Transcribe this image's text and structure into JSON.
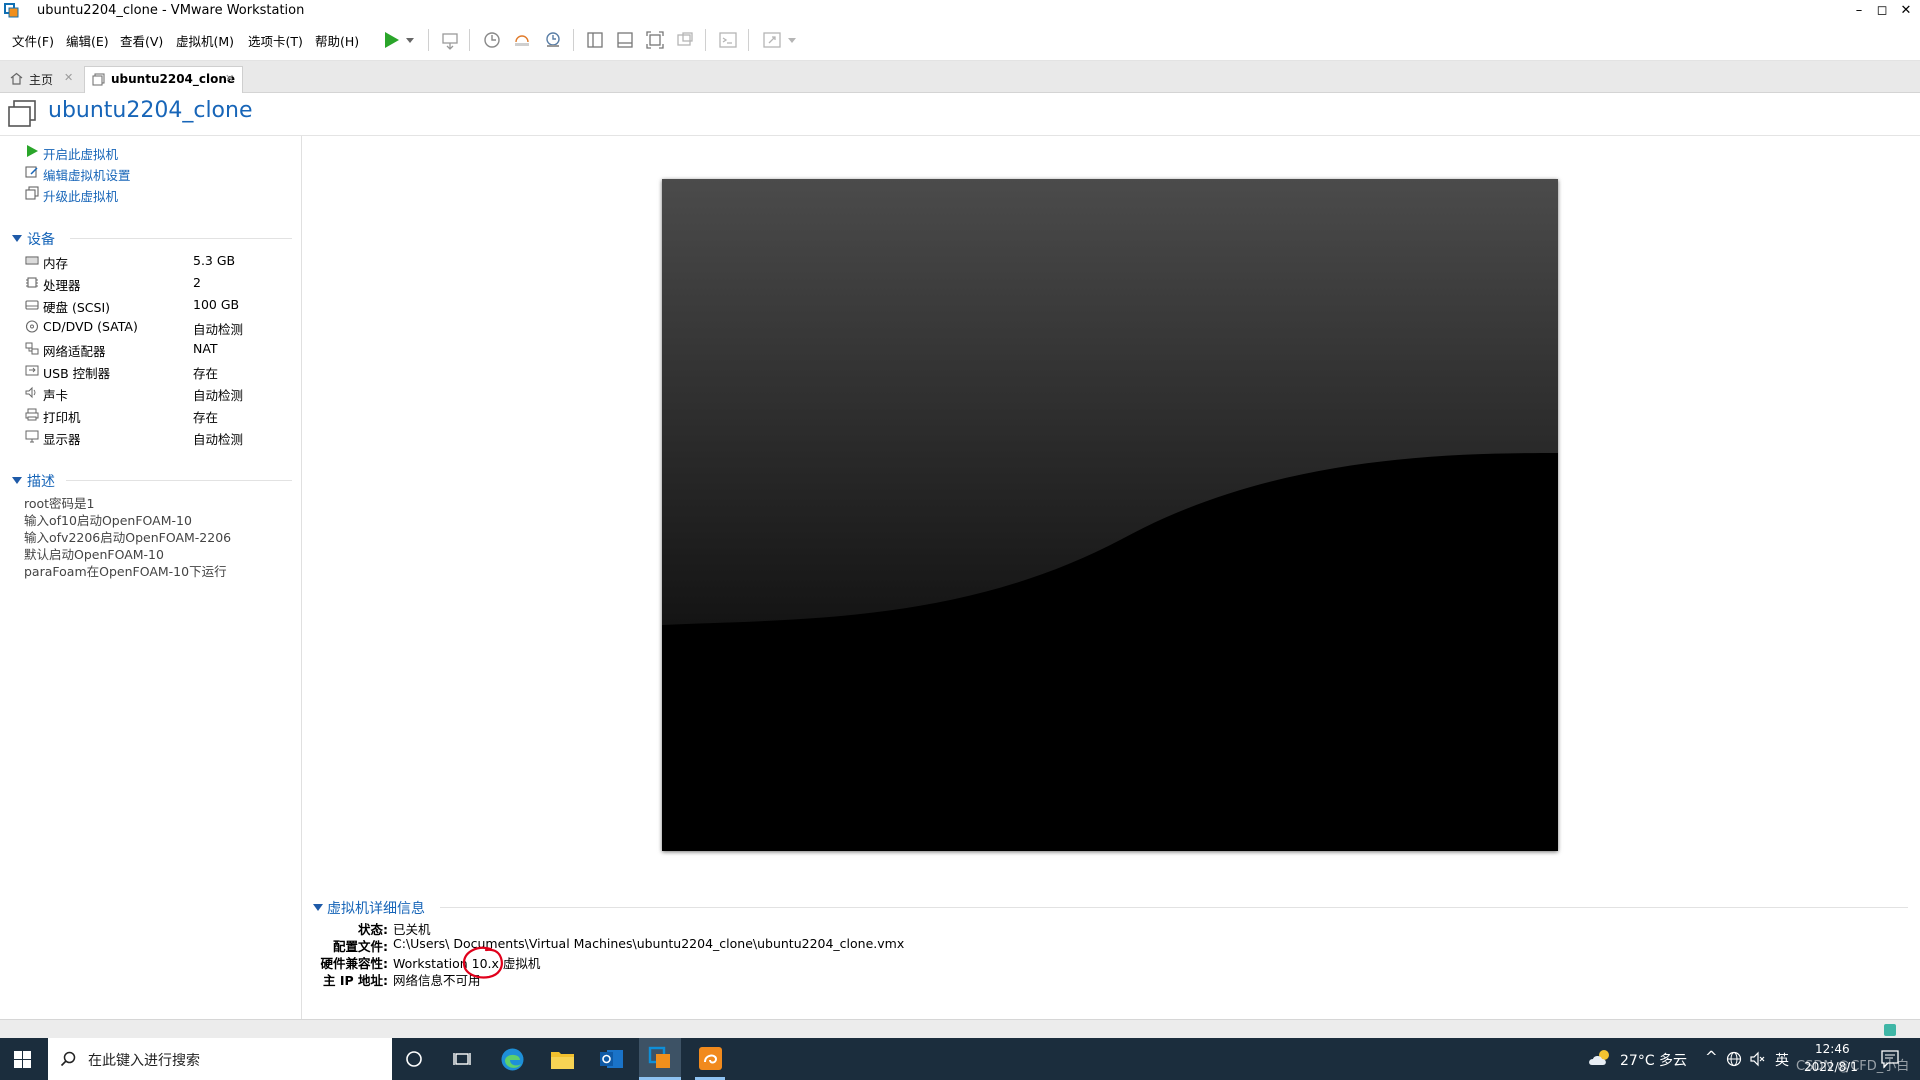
{
  "window": {
    "title": "ubuntu2204_clone - VMware Workstation",
    "minimize": "–",
    "maximize": "◻",
    "close": "✕"
  },
  "menu": {
    "items": [
      "文件(F)",
      "编辑(E)",
      "查看(V)",
      "虚拟机(M)",
      "选项卡(T)",
      "帮助(H)"
    ]
  },
  "tabs": {
    "home": "主页",
    "vm": "ubuntu2204_clone",
    "close_glyph": "✕"
  },
  "vm": {
    "name": "ubuntu2204_clone"
  },
  "actions": {
    "power_on": "开启此虚拟机",
    "edit_settings": "编辑虚拟机设置",
    "upgrade": "升级此虚拟机"
  },
  "devices": {
    "title": "设备",
    "items": [
      {
        "name": "内存",
        "value": "5.3 GB",
        "icon": "memory-icon"
      },
      {
        "name": "处理器",
        "value": "2",
        "icon": "cpu-icon"
      },
      {
        "name": "硬盘 (SCSI)",
        "value": "100 GB",
        "icon": "harddisk-icon"
      },
      {
        "name": "CD/DVD (SATA)",
        "value": "自动检测",
        "icon": "cdrom-icon"
      },
      {
        "name": "网络适配器",
        "value": "NAT",
        "icon": "network-icon"
      },
      {
        "name": "USB 控制器",
        "value": "存在",
        "icon": "usb-icon"
      },
      {
        "name": "声卡",
        "value": "自动检测",
        "icon": "sound-icon"
      },
      {
        "name": "打印机",
        "value": "存在",
        "icon": "printer-icon"
      },
      {
        "name": "显示器",
        "value": "自动检测",
        "icon": "display-icon"
      }
    ]
  },
  "description": {
    "title": "描述",
    "lines": [
      "root密码是1",
      "输入of10启动OpenFOAM-10",
      "输入ofv2206启动OpenFOAM-2206",
      "默认启动OpenFOAM-10",
      "paraFoam在OpenFOAM-10下运行"
    ]
  },
  "details": {
    "title": "虚拟机详细信息",
    "rows": [
      {
        "label": "状态:",
        "value": "已关机"
      },
      {
        "label": "配置文件:",
        "value": "C:\\Users\\             Documents\\Virtual Machines\\ubuntu2204_clone\\ubuntu2204_clone.vmx"
      },
      {
        "label": "硬件兼容性:",
        "value": "Workstation 10.x 虚拟机"
      },
      {
        "label": "主 IP 地址:",
        "value": "网络信息不可用"
      }
    ]
  },
  "taskbar": {
    "search_placeholder": "在此键入进行搜索",
    "weather": "27°C  多云",
    "ime": "英",
    "time": "12:46",
    "date": "2022/8/1",
    "watermark": "CSDN @CFD_小白"
  },
  "colors": {
    "link": "#1765b8",
    "taskbar": "#1b2d3d",
    "annotation": "#e0001b"
  }
}
